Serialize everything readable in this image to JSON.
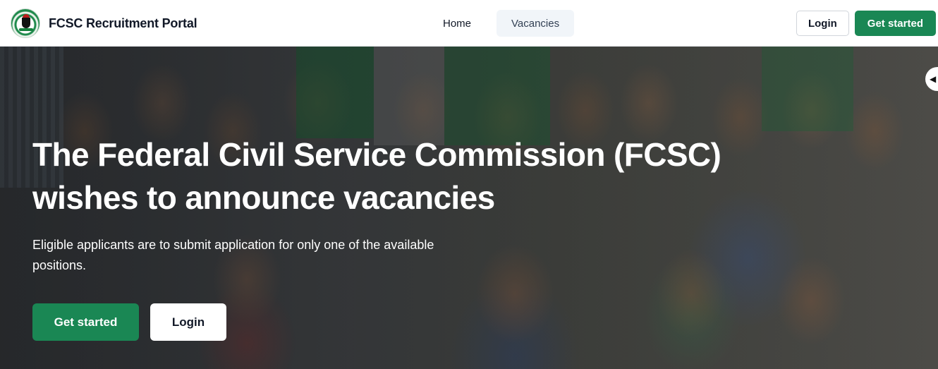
{
  "header": {
    "brand_title": "FCSC Recruitment Portal",
    "nav": [
      {
        "label": "Home"
      },
      {
        "label": "Vacancies"
      }
    ],
    "login_label": "Login",
    "get_started_label": "Get started"
  },
  "hero": {
    "title": "The Federal Civil Service Commission (FCSC) wishes to announce vacancies",
    "subtitle": "Eligible applicants are to submit application for only one of the available positions.",
    "primary_button": "Get started",
    "secondary_button": "Login",
    "carousel_prev_icon": "chevron-left-icon"
  },
  "colors": {
    "brand_green": "#1a8754",
    "active_nav_bg": "#f1f5f9"
  }
}
